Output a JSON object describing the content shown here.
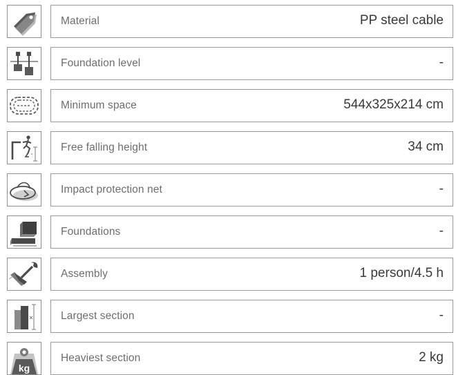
{
  "specs": [
    {
      "icon": "price-tag-icon",
      "label": "Material",
      "value": "PP steel cable"
    },
    {
      "icon": "foundation-level-icon",
      "label": "Foundation level",
      "value": "-"
    },
    {
      "icon": "minimum-space-icon",
      "label": "Minimum space",
      "value": "544x325x214 cm"
    },
    {
      "icon": "falling-person-icon",
      "label": "Free falling height",
      "value": "34 cm"
    },
    {
      "icon": "impact-area-icon",
      "label": "Impact protection net",
      "value": "-"
    },
    {
      "icon": "foundation-block-icon",
      "label": "Foundations",
      "value": "-"
    },
    {
      "icon": "wrench-hand-icon",
      "label": "Assembly",
      "value": "1 person/4.5 h"
    },
    {
      "icon": "largest-section-icon",
      "label": "Largest section",
      "value": "-"
    },
    {
      "icon": "weight-kg-icon",
      "label": "Heaviest section",
      "value": "2 kg"
    }
  ],
  "icon_text": {
    "kg": "kg"
  },
  "colors": {
    "icon_dark": "#4a4a4a",
    "icon_mid": "#8a8a8a",
    "icon_light": "#c4c4c4",
    "border": "#9a9a9a"
  }
}
